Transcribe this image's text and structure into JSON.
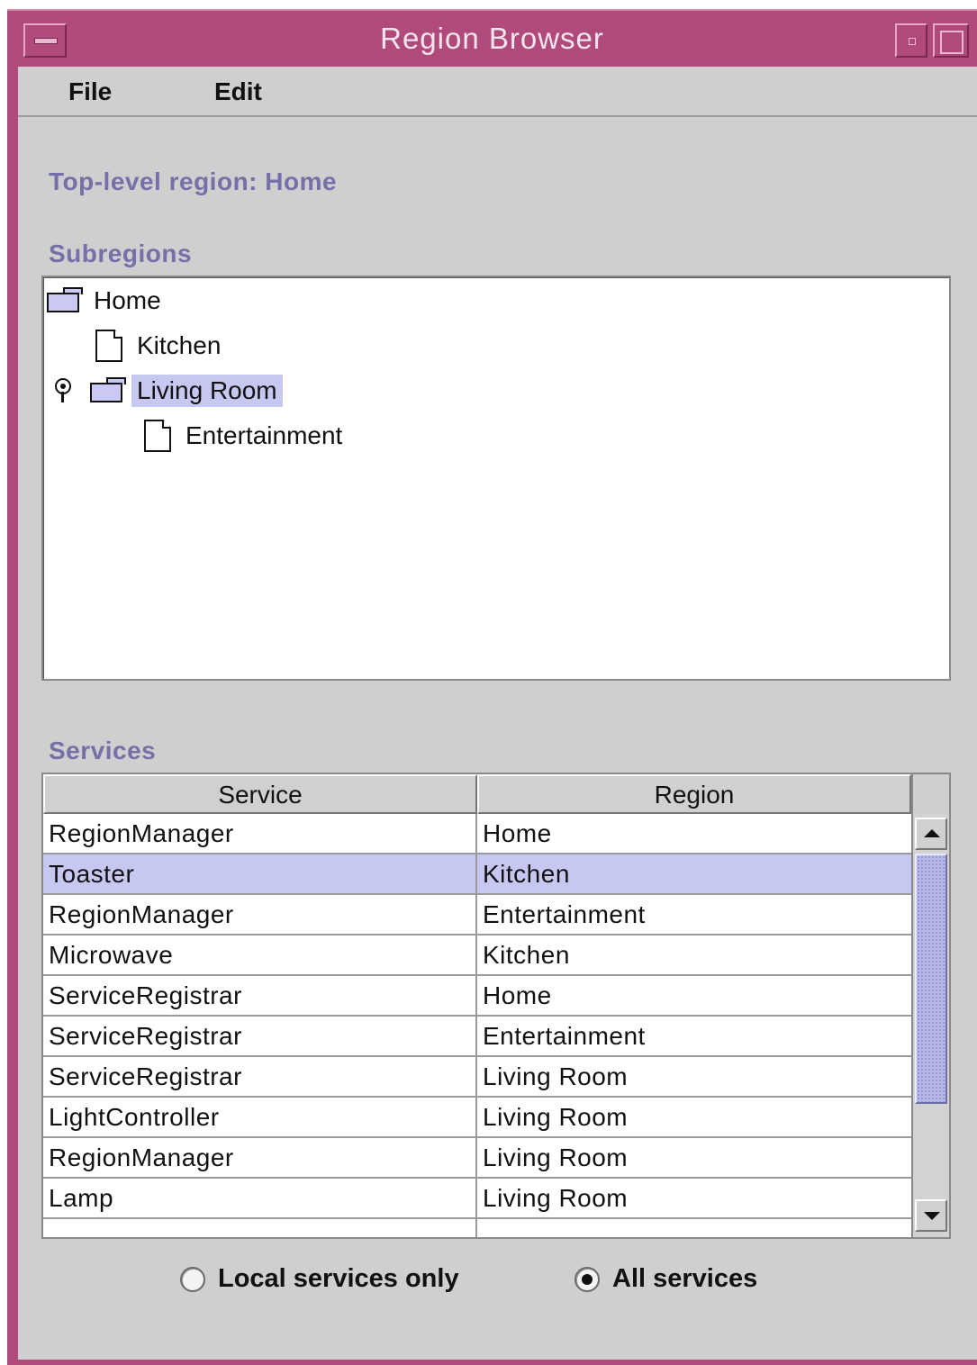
{
  "window": {
    "title": "Region Browser"
  },
  "menubar": {
    "items": [
      {
        "label": "File"
      },
      {
        "label": "Edit"
      }
    ]
  },
  "top_level": {
    "text": "Top-level region: Home"
  },
  "subregions": {
    "heading": "Subregions",
    "nodes": [
      {
        "label": "Home",
        "type": "folder"
      },
      {
        "label": "Kitchen",
        "type": "leaf"
      },
      {
        "label": "Living Room",
        "type": "folder",
        "selected": true
      },
      {
        "label": "Entertainment",
        "type": "leaf"
      }
    ]
  },
  "services": {
    "heading": "Services",
    "columns": [
      "Service",
      "Region"
    ],
    "rows": [
      {
        "service": "RegionManager",
        "region": "Home"
      },
      {
        "service": "Toaster",
        "region": "Kitchen",
        "selected": true
      },
      {
        "service": "RegionManager",
        "region": "Entertainment"
      },
      {
        "service": "Microwave",
        "region": "Kitchen"
      },
      {
        "service": "ServiceRegistrar",
        "region": "Home"
      },
      {
        "service": "ServiceRegistrar",
        "region": "Entertainment"
      },
      {
        "service": "ServiceRegistrar",
        "region": "Living Room"
      },
      {
        "service": "LightController",
        "region": "Living Room"
      },
      {
        "service": "RegionManager",
        "region": "Living Room"
      },
      {
        "service": "Lamp",
        "region": "Living Room"
      }
    ]
  },
  "filter": {
    "options": [
      {
        "label": "Local services only",
        "checked": false
      },
      {
        "label": "All services",
        "checked": true
      }
    ]
  },
  "colors": {
    "titlebar": "#b04a7a",
    "heading": "#7570a8",
    "selection": "#c7c8f2",
    "background": "#cfcfcf"
  }
}
